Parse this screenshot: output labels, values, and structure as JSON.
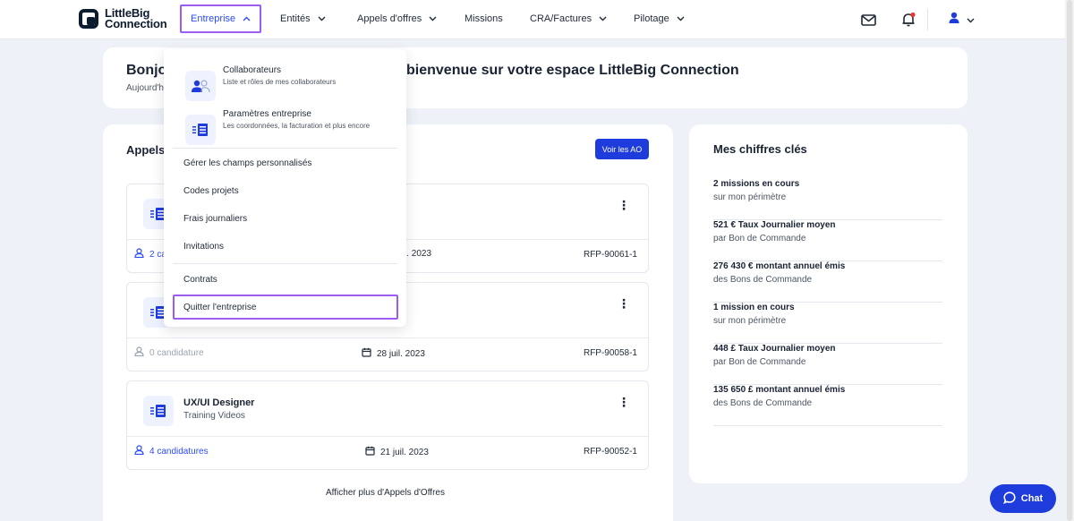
{
  "brand": {
    "line1": "LittleBig",
    "line2": "Connection"
  },
  "nav": {
    "items": [
      {
        "label": "Entreprise",
        "active": true
      },
      {
        "label": "Entités"
      },
      {
        "label": "Appels d'offres"
      },
      {
        "label": "Missions"
      },
      {
        "label": "CRA/Factures"
      },
      {
        "label": "Pilotage"
      }
    ]
  },
  "icons": {
    "mail": "mail-icon",
    "bell": "bell-icon",
    "user": "user-icon",
    "notification_dot_color": "#e53935",
    "accent": "#1e3bdb",
    "highlight": "#9a5cf5"
  },
  "welcome": {
    "title_start": "Bonjo",
    "title_end": "bienvenue sur votre espace LittleBig Connection",
    "subtitle": "Aujourd'h"
  },
  "ao": {
    "title": "Appels",
    "view_button": "Voir les AO",
    "cards": [
      {
        "name": "",
        "client": "",
        "candidatures": "2 ca",
        "date": "l. 2023",
        "ref": "RFP-90061-1"
      },
      {
        "name": "",
        "client": "",
        "candidatures": "0 candidature",
        "date": "28 juil. 2023",
        "ref": "RFP-90058-1"
      },
      {
        "name": "UX/UI Designer",
        "client": "Training Videos",
        "candidatures": "4 candidatures",
        "date": "21 juil. 2023",
        "ref": "RFP-90052-1"
      }
    ],
    "more": "Afficher plus d'Appels d'Offres"
  },
  "kpi": {
    "title": "Mes chiffres clés",
    "items": [
      {
        "value": "2 missions en cours",
        "desc": "sur mon périmètre"
      },
      {
        "value": "521 € Taux Journalier moyen",
        "desc": "par Bon de Commande"
      },
      {
        "value": "276 430 € montant annuel émis",
        "desc": "des Bons de Commande"
      },
      {
        "value": "1 mission en cours",
        "desc": "sur mon périmètre"
      },
      {
        "value": "448 £ Taux Journalier moyen",
        "desc": "par Bon de Commande"
      },
      {
        "value": "135 650 £ montant annuel émis",
        "desc": "des Bons de Commande"
      }
    ]
  },
  "dropdown": {
    "rich_items": [
      {
        "title": "Collaborateurs",
        "subtitle": "Liste et rôles de mes collaborateurs"
      },
      {
        "title": "Paramètres entreprise",
        "subtitle": "Les coordonnées, la facturation et plus encore"
      }
    ],
    "items": [
      "Gérer les champs personnalisés",
      "Codes projets",
      "Frais journaliers",
      "Invitations",
      "Contrats",
      "Quitter l'entreprise"
    ]
  },
  "chat": {
    "label": "Chat"
  }
}
